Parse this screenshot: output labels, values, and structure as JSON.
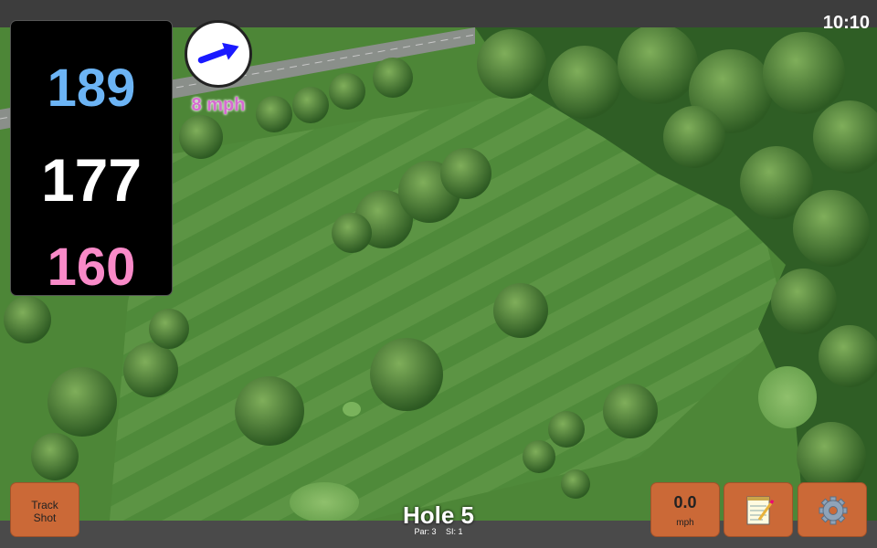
{
  "status": {
    "time": "10:10"
  },
  "distances": {
    "back": "189",
    "middle": "177",
    "front": "160"
  },
  "wind": {
    "speed_label": "8 mph",
    "direction_icon": "arrow-right-icon"
  },
  "hole": {
    "title": "Hole 5",
    "par": "Par: 3",
    "si": "SI: 1"
  },
  "buttons": {
    "track_shot": {
      "line1": "Track",
      "line2": "Shot"
    },
    "wind_speed": {
      "value": "0.0",
      "unit": "mph"
    },
    "notes_icon": "notepad-icon",
    "settings_icon": "gear-icon"
  },
  "colors": {
    "back": "#6cb4f5",
    "middle": "#ffffff",
    "front": "#f98ac8",
    "button": "#cb6937",
    "wind_text": "#d66bd0"
  }
}
